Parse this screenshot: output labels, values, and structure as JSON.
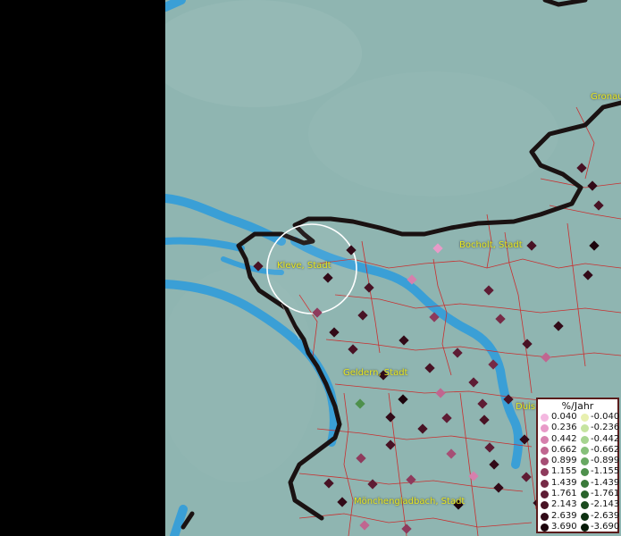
{
  "map": {
    "background_color": "#8fb5b1",
    "water_color": "#3a9fd6",
    "border_color": "#1a1212",
    "district_line_color": "#c83030",
    "cities": [
      {
        "name": "Gronau",
        "visible_text": "Gronau"
      },
      {
        "name": "Bocholt, Stadt"
      },
      {
        "name": "Kleve, Stadt"
      },
      {
        "name": "Geldern, Stadt"
      },
      {
        "name": "Duis"
      },
      {
        "name": "Mönchengladbach, Stadt"
      }
    ],
    "selection_circle": {
      "color": "#ffffff"
    }
  },
  "legend": {
    "title": "%/Jahr",
    "positive": [
      {
        "label": "0.040",
        "color": "#f4b8e0"
      },
      {
        "label": "0.236",
        "color": "#e89ac8"
      },
      {
        "label": "0.442",
        "color": "#d680ad"
      },
      {
        "label": "0.662",
        "color": "#c06690"
      },
      {
        "label": "0.899",
        "color": "#a64e75"
      },
      {
        "label": "1.155",
        "color": "#8e3a5c"
      },
      {
        "label": "1.439",
        "color": "#762a46"
      },
      {
        "label": "1.761",
        "color": "#5e1c34"
      },
      {
        "label": "2.143",
        "color": "#481224"
      },
      {
        "label": "2.639",
        "color": "#320a18"
      },
      {
        "label": "3.690",
        "color": "#1c040c"
      }
    ],
    "negative": [
      {
        "label": "-0.040",
        "color": "#e8f0b0"
      },
      {
        "label": "-0.236",
        "color": "#c6e4a0"
      },
      {
        "label": "-0.442",
        "color": "#a6d490"
      },
      {
        "label": "-0.662",
        "color": "#86c07a"
      },
      {
        "label": "-0.899",
        "color": "#68a862"
      },
      {
        "label": "-1.155",
        "color": "#4e904c"
      },
      {
        "label": "-1.439",
        "color": "#3a7a3a"
      },
      {
        "label": "-1.761",
        "color": "#28622a"
      },
      {
        "label": "-2.143",
        "color": "#1a4a1e"
      },
      {
        "label": "-2.639",
        "color": "#0e3212"
      },
      {
        "label": "-3.690",
        "color": "#061a08"
      }
    ]
  }
}
